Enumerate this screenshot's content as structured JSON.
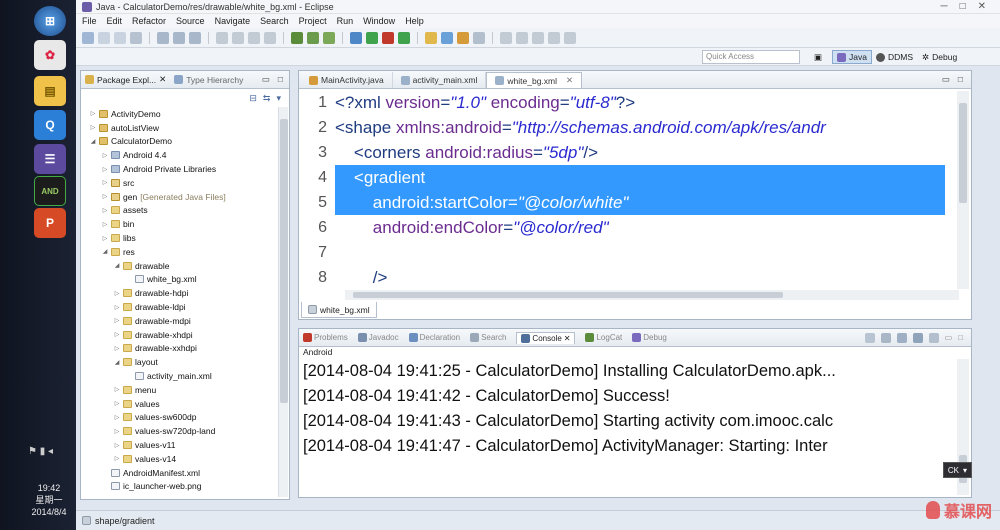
{
  "window": {
    "title": "Java - CalculatorDemo/res/drawable/white_bg.xml - Eclipse"
  },
  "menu": [
    "File",
    "Edit",
    "Refactor",
    "Source",
    "Navigate",
    "Search",
    "Project",
    "Run",
    "Window",
    "Help"
  ],
  "toolbar": {
    "quick_access_placeholder": "Quick Access",
    "perspectives": [
      "Java",
      "DDMS",
      "Debug"
    ]
  },
  "package_explorer": {
    "tabs": [
      "Package Expl...",
      "Type Hierarchy"
    ],
    "tree": [
      {
        "label": "ActivityDemo",
        "icon": "project",
        "expanded": false
      },
      {
        "label": "autoListView",
        "icon": "project",
        "expanded": false
      },
      {
        "label": "CalculatorDemo",
        "icon": "project",
        "expanded": true
      },
      {
        "label": "Android 4.4",
        "icon": "library",
        "expanded": false
      },
      {
        "label": "Android Private Libraries",
        "icon": "library",
        "expanded": false
      },
      {
        "label": "src",
        "icon": "source-folder",
        "expanded": false
      },
      {
        "label": "gen",
        "suffix": "[Generated Java Files]",
        "icon": "source-folder",
        "expanded": false
      },
      {
        "label": "assets",
        "icon": "folder",
        "expanded": false
      },
      {
        "label": "bin",
        "icon": "folder",
        "expanded": false
      },
      {
        "label": "libs",
        "icon": "folder",
        "expanded": false
      },
      {
        "label": "res",
        "icon": "folder",
        "expanded": true
      },
      {
        "label": "drawable",
        "icon": "folder",
        "expanded": true
      },
      {
        "label": "white_bg.xml",
        "icon": "file"
      },
      {
        "label": "drawable-hdpi",
        "icon": "folder",
        "expanded": false
      },
      {
        "label": "drawable-ldpi",
        "icon": "folder",
        "expanded": false
      },
      {
        "label": "drawable-mdpi",
        "icon": "folder",
        "expanded": false
      },
      {
        "label": "drawable-xhdpi",
        "icon": "folder",
        "expanded": false
      },
      {
        "label": "drawable-xxhdpi",
        "icon": "folder",
        "expanded": false
      },
      {
        "label": "layout",
        "icon": "folder",
        "expanded": true
      },
      {
        "label": "activity_main.xml",
        "icon": "file"
      },
      {
        "label": "menu",
        "icon": "folder",
        "expanded": false
      },
      {
        "label": "values",
        "icon": "folder",
        "expanded": false
      },
      {
        "label": "values-sw600dp",
        "icon": "folder",
        "expanded": false
      },
      {
        "label": "values-sw720dp-land",
        "icon": "folder",
        "expanded": false
      },
      {
        "label": "values-v11",
        "icon": "folder",
        "expanded": false
      },
      {
        "label": "values-v14",
        "icon": "folder",
        "expanded": false
      },
      {
        "label": "AndroidManifest.xml",
        "icon": "file"
      },
      {
        "label": "ic_launcher-web.png",
        "icon": "file"
      }
    ]
  },
  "editor": {
    "tabs": [
      {
        "label": "MainActivity.java",
        "active": false
      },
      {
        "label": "activity_main.xml",
        "active": false
      },
      {
        "label": "white_bg.xml",
        "active": true
      }
    ],
    "bottom_tab": "white_bg.xml",
    "lines": [
      {
        "n": "1",
        "parts": [
          [
            "t",
            "<?xml "
          ],
          [
            "a",
            "version"
          ],
          [
            "t",
            "="
          ],
          [
            "v",
            "\"1.0\""
          ],
          [
            "a",
            " encoding"
          ],
          [
            "t",
            "="
          ],
          [
            "v",
            "\"utf-8\""
          ],
          [
            "t",
            "?>"
          ]
        ]
      },
      {
        "n": "2",
        "parts": [
          [
            "t",
            "<shape "
          ],
          [
            "a",
            "xmlns:android"
          ],
          [
            "t",
            "="
          ],
          [
            "v",
            "\"http://schemas.android.com/apk/res/andr"
          ]
        ]
      },
      {
        "n": "3",
        "parts": [
          [
            "t",
            "    <corners "
          ],
          [
            "a",
            "android:radius"
          ],
          [
            "t",
            "="
          ],
          [
            "v",
            "\"5dp\""
          ],
          [
            "t",
            "/>"
          ]
        ]
      },
      {
        "n": "4",
        "parts": [
          [
            "t",
            "    <gradient"
          ]
        ],
        "selected": true
      },
      {
        "n": "5",
        "parts": [
          [
            "a",
            "        android:startColor"
          ],
          [
            "t",
            "="
          ],
          [
            "v",
            "\"@color/white\""
          ]
        ],
        "selected": true
      },
      {
        "n": "6",
        "parts": [
          [
            "a",
            "        android:endColor"
          ],
          [
            "t",
            "="
          ],
          [
            "v",
            "\"@color/red\""
          ]
        ]
      },
      {
        "n": "7",
        "parts": []
      },
      {
        "n": "8",
        "parts": [
          [
            "t",
            "        />"
          ]
        ]
      }
    ]
  },
  "console": {
    "tabs": [
      "Problems",
      "Javadoc",
      "Declaration",
      "Search",
      "Console",
      "LogCat",
      "Debug"
    ],
    "active_tab": "Console",
    "subtitle": "Android",
    "lines": [
      "[2014-08-04 19:41:25 - CalculatorDemo] Installing CalculatorDemo.apk...",
      "[2014-08-04 19:41:42 - CalculatorDemo] Success!",
      "[2014-08-04 19:41:43 - CalculatorDemo] Starting activity com.imooc.calc",
      "[2014-08-04 19:41:47 - CalculatorDemo] ActivityManager: Starting: Inter"
    ]
  },
  "status_bar": {
    "text": "shape/gradient"
  },
  "taskbar": {
    "time": "19:42",
    "weekday": "星期一",
    "date": "2014/8/4",
    "ime": "CK"
  },
  "watermark": "慕课网"
}
